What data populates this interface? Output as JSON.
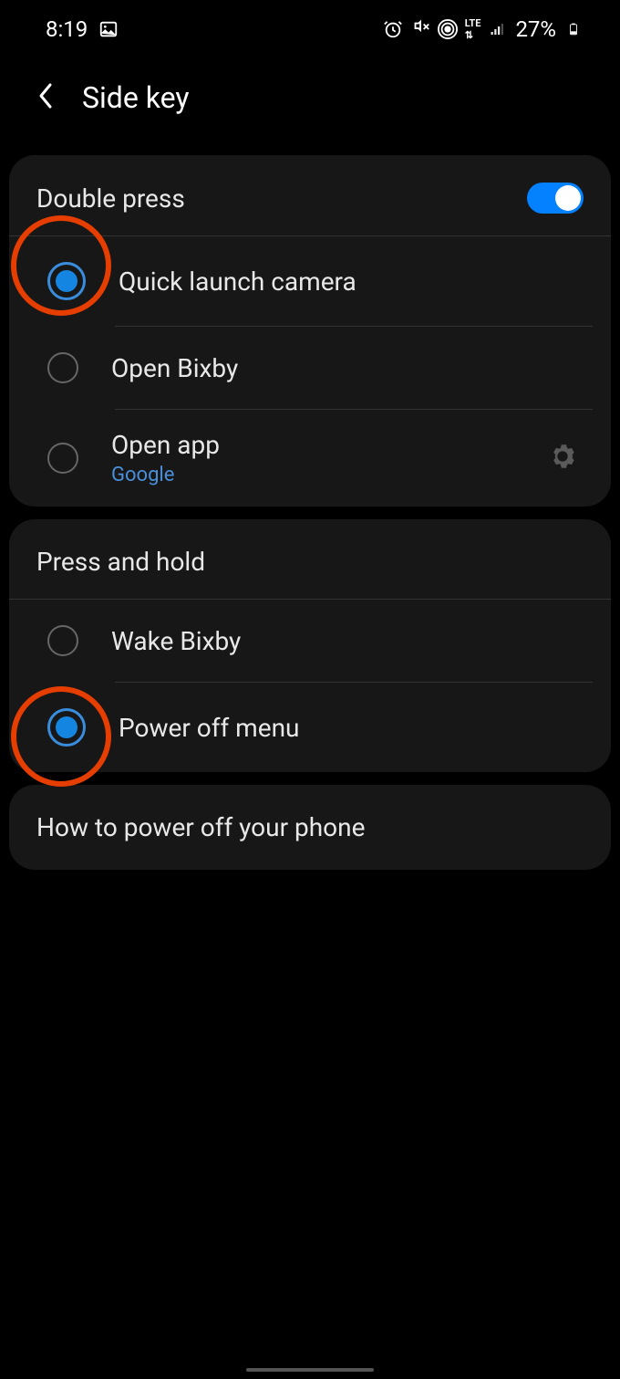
{
  "statusBar": {
    "time": "8:19",
    "batteryPercent": "27%"
  },
  "header": {
    "title": "Side key"
  },
  "sections": {
    "doublePress": {
      "title": "Double press",
      "enabled": true,
      "options": {
        "quickLaunchCamera": {
          "label": "Quick launch camera",
          "selected": true
        },
        "openBixby": {
          "label": "Open Bixby",
          "selected": false
        },
        "openApp": {
          "label": "Open app",
          "sublabel": "Google",
          "selected": false
        }
      }
    },
    "pressHold": {
      "title": "Press and hold",
      "options": {
        "wakeBixby": {
          "label": "Wake Bixby",
          "selected": false
        },
        "powerOff": {
          "label": "Power off menu",
          "selected": true
        }
      }
    },
    "info": {
      "text": "How to power off your phone"
    }
  }
}
